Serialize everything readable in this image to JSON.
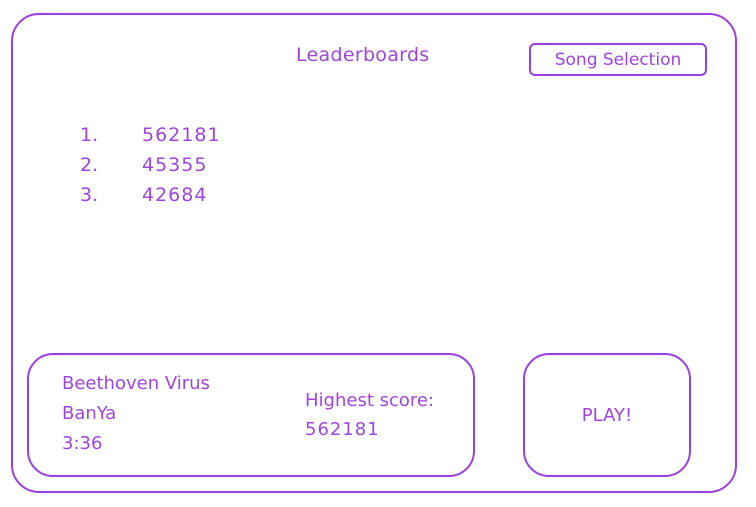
{
  "header": {
    "title": "Leaderboards",
    "song_selection_label": "Song Selection"
  },
  "leaderboard": {
    "entries": [
      {
        "rank": "1.",
        "score": "562181"
      },
      {
        "rank": "2.",
        "score": "45355"
      },
      {
        "rank": "3.",
        "score": "42684"
      }
    ]
  },
  "song": {
    "name": "Beethoven Virus",
    "artist": "BanYa",
    "length": "3:36",
    "highest_score_label": "Highest score:",
    "highest_score_value": "562181"
  },
  "play": {
    "label": "PLAY!"
  },
  "colors": {
    "accent": "#9d3fe0",
    "background": "#ffffff"
  }
}
